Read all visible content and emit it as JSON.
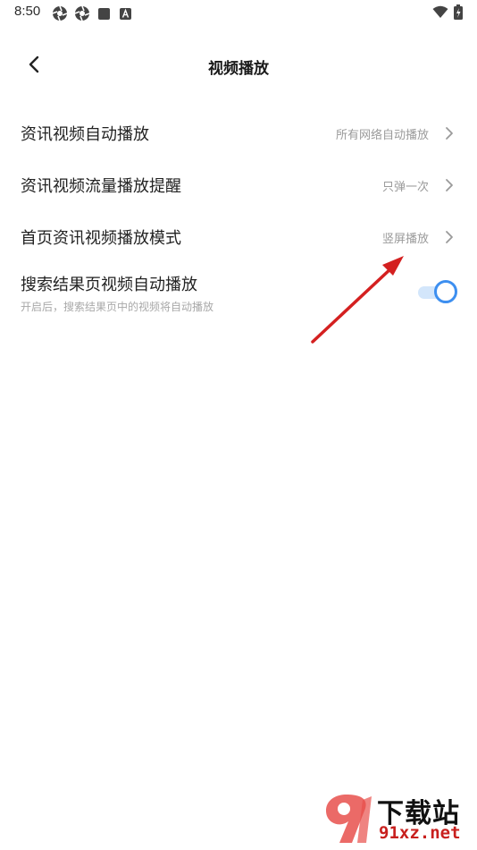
{
  "status_bar": {
    "time": "8:50",
    "left_icons": [
      "aperture-icon",
      "aperture-icon",
      "stop-square-icon",
      "a-badge-icon"
    ],
    "right_icons": [
      "wifi-icon",
      "battery-icon"
    ]
  },
  "header": {
    "title": "视频播放",
    "back_icon": "chevron-left-icon"
  },
  "settings": [
    {
      "label": "资讯视频自动播放",
      "value": "所有网络自动播放"
    },
    {
      "label": "资讯视频流量播放提醒",
      "value": "只弹一次"
    },
    {
      "label": "首页资讯视频播放模式",
      "value": "竖屏播放"
    }
  ],
  "toggle_setting": {
    "label": "搜索结果页视频自动播放",
    "description": "开启后，搜索结果页中的视频将自动播放",
    "enabled": true
  },
  "colors": {
    "accent": "#3d8ff0",
    "track": "#d3e6fb",
    "annotation": "#d42020"
  },
  "watermark": {
    "top_text": "下载站",
    "bottom_text": "91xz.net"
  }
}
